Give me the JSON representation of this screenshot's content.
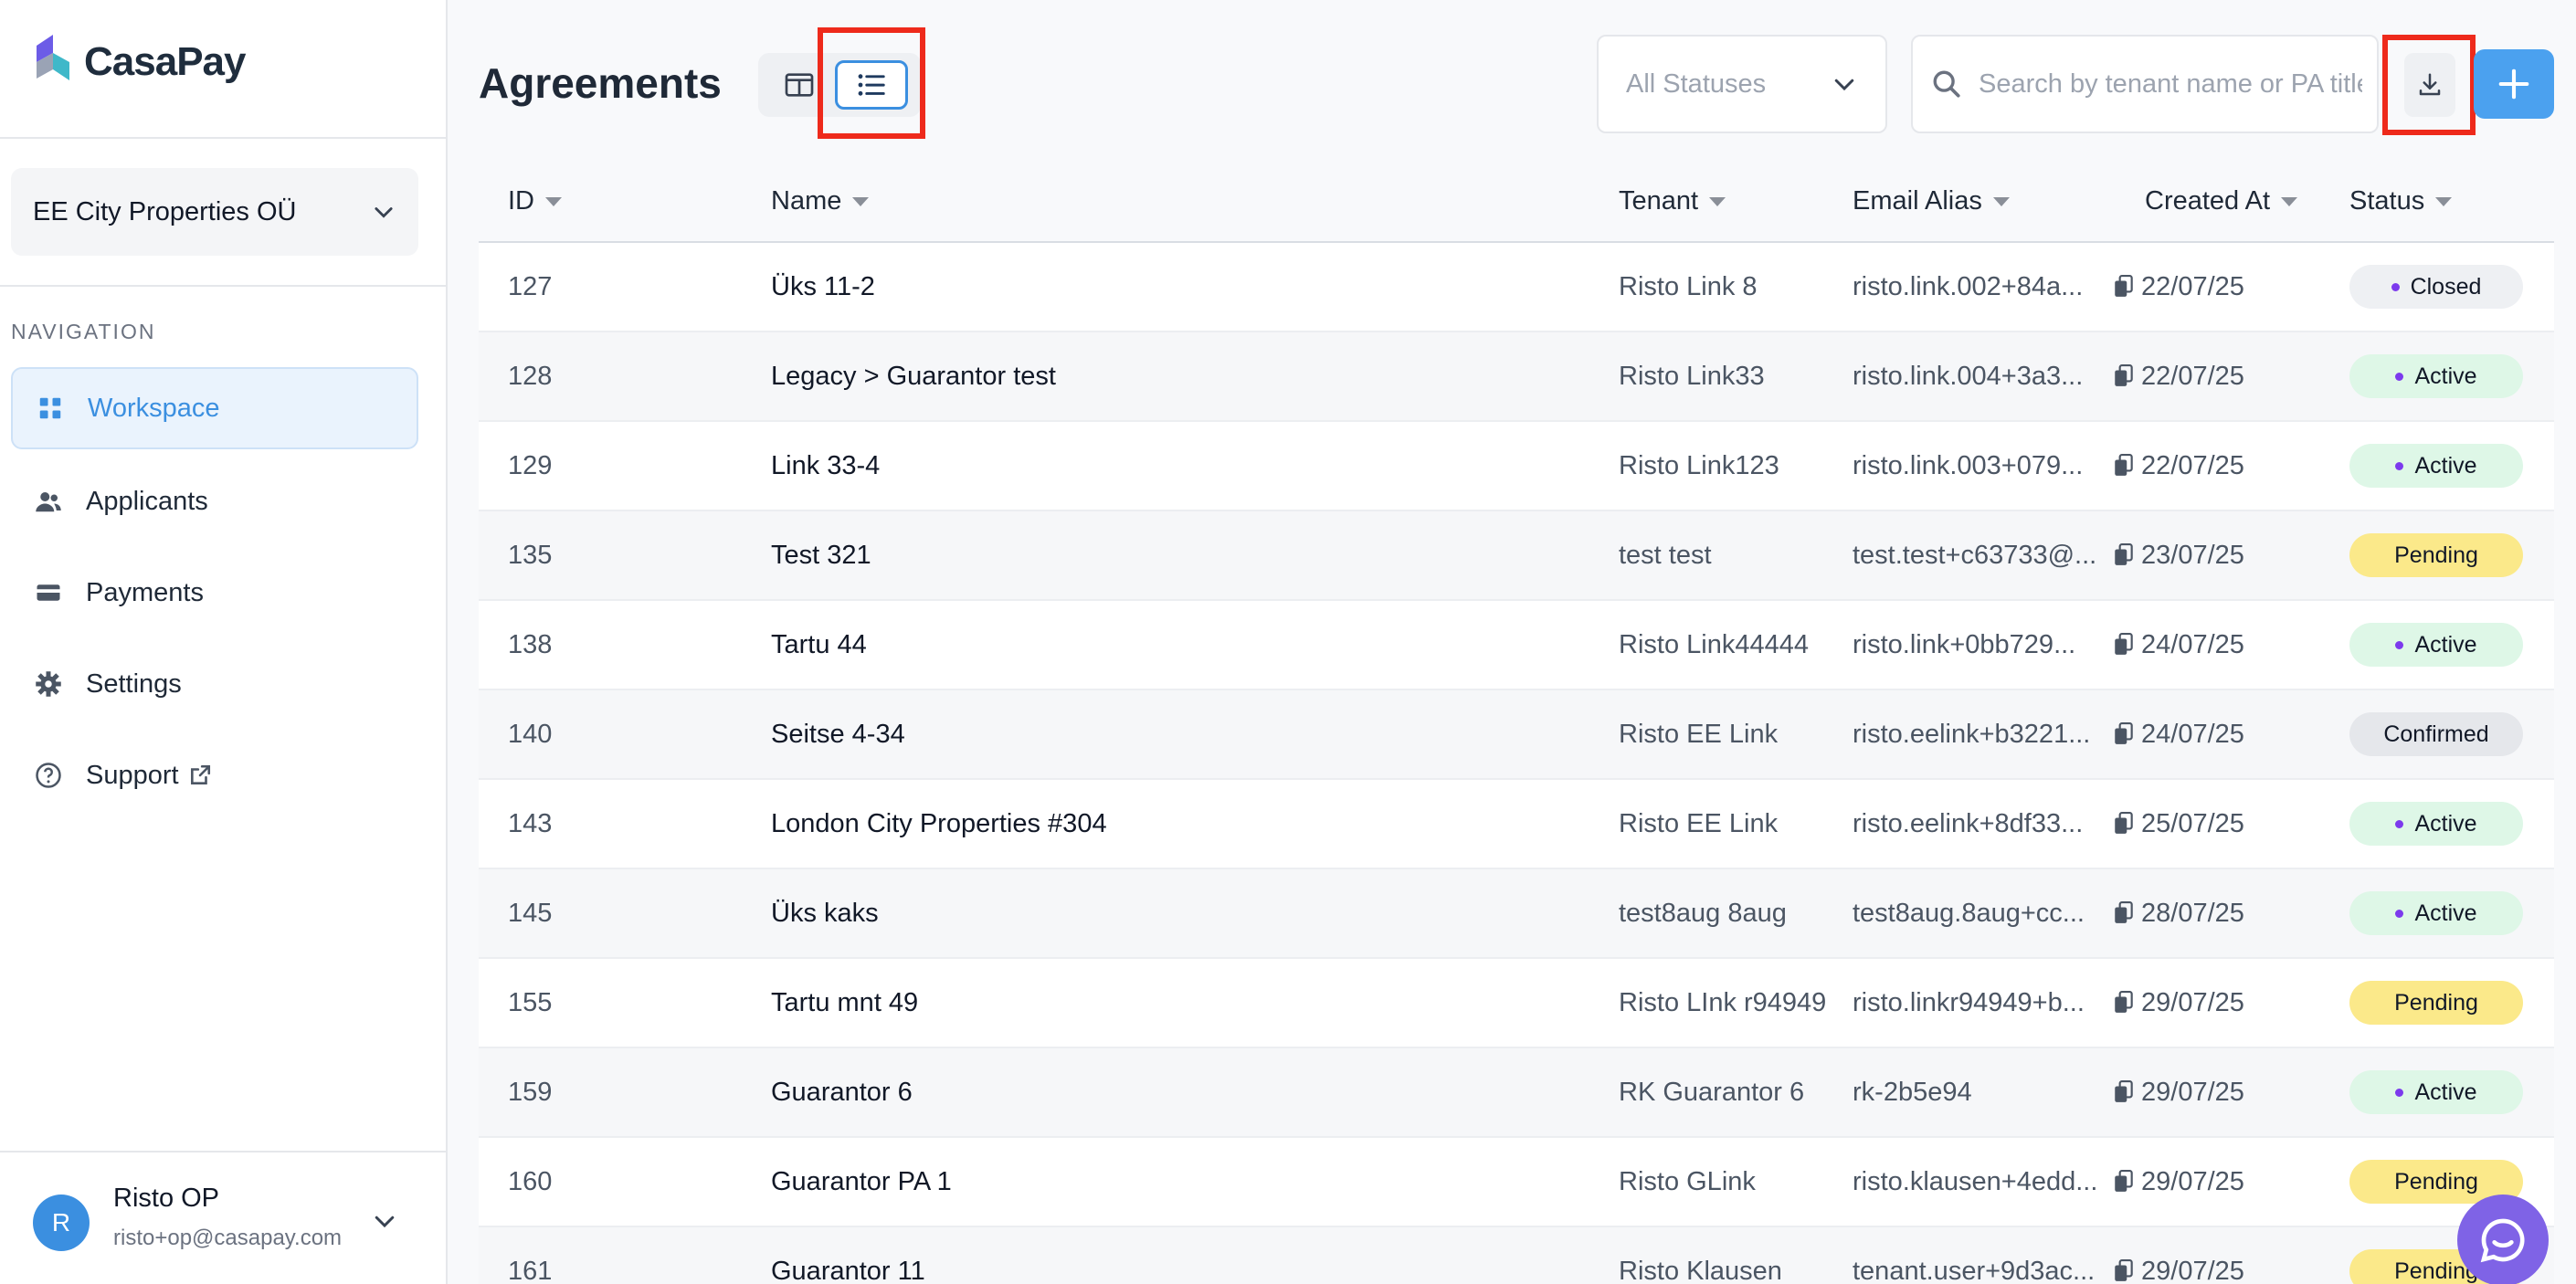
{
  "brand": {
    "name": "CasaPay"
  },
  "org": {
    "name": "EE City Properties OÜ"
  },
  "nav": {
    "heading": "NAVIGATION",
    "items": [
      {
        "label": "Workspace",
        "icon": "grid-icon",
        "active": true
      },
      {
        "label": "Applicants",
        "icon": "users-icon",
        "active": false
      },
      {
        "label": "Payments",
        "icon": "credit-card-icon",
        "active": false
      },
      {
        "label": "Settings",
        "icon": "gear-icon",
        "active": false
      },
      {
        "label": "Support",
        "icon": "help-circle-icon",
        "active": false
      }
    ]
  },
  "user": {
    "initial": "R",
    "name": "Risto OP",
    "email": "risto+op@casapay.com"
  },
  "header": {
    "title": "Agreements",
    "status_filter": "All Statuses",
    "search_placeholder": "Search by tenant name or PA title"
  },
  "table": {
    "columns": [
      "ID",
      "Name",
      "Tenant",
      "Email Alias",
      "Created At",
      "Status"
    ],
    "rows": [
      {
        "id": "127",
        "name": "Üks 11-2",
        "tenant": "Risto Link 8",
        "email": "risto.link.002+84a...",
        "created": "22/07/25",
        "status": "Closed"
      },
      {
        "id": "128",
        "name": "Legacy > Guarantor test",
        "tenant": "Risto Link33",
        "email": "risto.link.004+3a3...",
        "created": "22/07/25",
        "status": "Active"
      },
      {
        "id": "129",
        "name": "Link 33-4",
        "tenant": "Risto Link123",
        "email": "risto.link.003+079...",
        "created": "22/07/25",
        "status": "Active"
      },
      {
        "id": "135",
        "name": "Test 321",
        "tenant": "test test",
        "email": "test.test+c63733@...",
        "created": "23/07/25",
        "status": "Pending"
      },
      {
        "id": "138",
        "name": "Tartu 44",
        "tenant": "Risto Link44444",
        "email": "risto.link+0bb729...",
        "created": "24/07/25",
        "status": "Active"
      },
      {
        "id": "140",
        "name": "Seitse 4-34",
        "tenant": "Risto EE Link",
        "email": "risto.eelink+b3221...",
        "created": "24/07/25",
        "status": "Confirmed"
      },
      {
        "id": "143",
        "name": "London City Properties #304",
        "tenant": "Risto EE Link",
        "email": "risto.eelink+8df33...",
        "created": "25/07/25",
        "status": "Active"
      },
      {
        "id": "145",
        "name": "Üks kaks",
        "tenant": "test8aug 8aug",
        "email": "test8aug.8aug+cc...",
        "created": "28/07/25",
        "status": "Active"
      },
      {
        "id": "155",
        "name": "Tartu mnt 49",
        "tenant": "Risto LInk r94949",
        "email": "risto.linkr94949+b...",
        "created": "29/07/25",
        "status": "Pending"
      },
      {
        "id": "159",
        "name": "Guarantor 6",
        "tenant": "RK Guarantor 6",
        "email": "rk-2b5e94",
        "created": "29/07/25",
        "status": "Active"
      },
      {
        "id": "160",
        "name": "Guarantor PA 1",
        "tenant": "Risto GLink",
        "email": "risto.klausen+4edd...",
        "created": "29/07/25",
        "status": "Pending"
      },
      {
        "id": "161",
        "name": "Guarantor 11",
        "tenant": "Risto Klausen",
        "email": "tenant.user+9d3ac...",
        "created": "29/07/25",
        "status": "Pending"
      }
    ]
  },
  "status_colors": {
    "Closed": {
      "bg": "#eef0f3",
      "dot": "#7c3aed"
    },
    "Active": {
      "bg": "#def7e7",
      "dot": "#7c3aed"
    },
    "Pending": {
      "bg": "#fbe98a",
      "dot": ""
    },
    "Confirmed": {
      "bg": "#e5e7eb",
      "dot": ""
    }
  }
}
